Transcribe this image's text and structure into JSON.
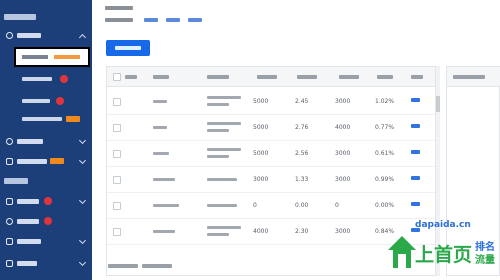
{
  "colors": {
    "sidebar_bg": "#1c3f7a",
    "accent": "#1769e8",
    "badge_red": "#e0353b",
    "badge_orange": "#f08a1d",
    "link": "#2f74e0",
    "watermark_green": "#2aa84a",
    "watermark_blue": "#2b6fd6"
  },
  "sidebar": {
    "items": [
      {
        "icon": "search-icon"
      },
      {
        "icon": "display-icon"
      },
      {
        "icon": "group-icon"
      },
      {
        "icon": "shield-icon"
      },
      {
        "icon": "search-ad-icon"
      },
      {
        "icon": "briefcase-icon"
      },
      {
        "icon": "store-icon"
      }
    ]
  },
  "table": {
    "rows": [
      {
        "keyword": "",
        "show": "5000",
        "avg_bid": "2.45",
        "competition": "3000",
        "ctr": "1.02%"
      },
      {
        "keyword": "",
        "show": "5000",
        "avg_bid": "2.76",
        "competition": "4000",
        "ctr": "0.77%"
      },
      {
        "keyword": "",
        "show": "5000",
        "avg_bid": "2.56",
        "competition": "3000",
        "ctr": "0.61%"
      },
      {
        "keyword": "",
        "show": "3000",
        "avg_bid": "1.33",
        "competition": "3000",
        "ctr": "0.99%"
      },
      {
        "keyword": "",
        "show": "0",
        "avg_bid": "0.00",
        "competition": "0",
        "ctr": "0.00%"
      },
      {
        "keyword": "",
        "show": "4000",
        "avg_bid": "2.30",
        "competition": "3000",
        "ctr": "0.84%"
      }
    ]
  },
  "watermark": {
    "site": "dapaida.cn",
    "brand": "上首页",
    "sub1": "排名",
    "sub2": "流量"
  }
}
